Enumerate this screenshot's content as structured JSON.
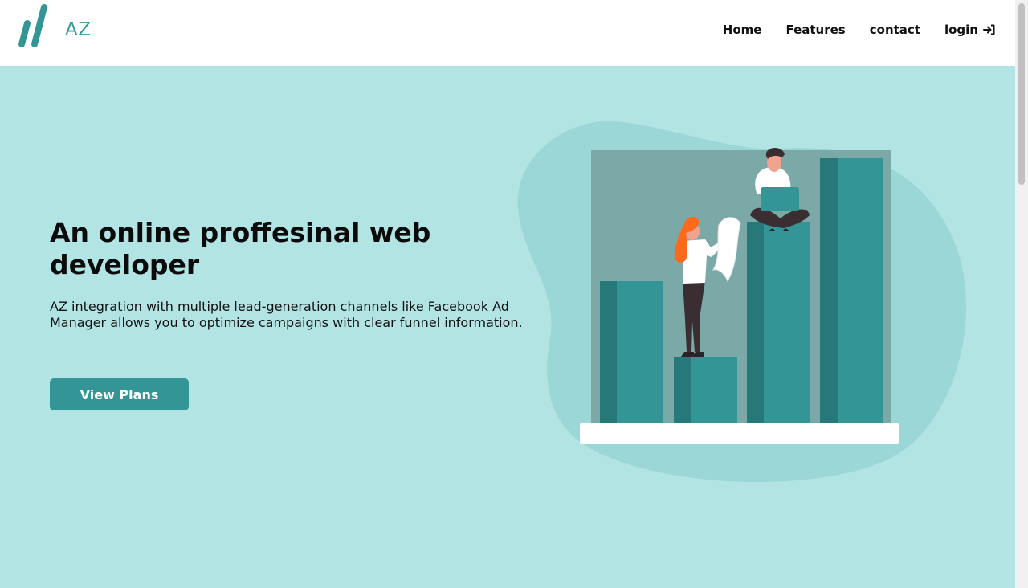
{
  "brand": {
    "name": "AZ",
    "accent": "#339595"
  },
  "nav": {
    "items": [
      {
        "label": "Home"
      },
      {
        "label": "Features"
      },
      {
        "label": "contact"
      },
      {
        "label": "login",
        "icon": "login-icon"
      }
    ]
  },
  "hero": {
    "headline": "An online proffesinal web developer",
    "description": "AZ integration with multiple lead-generation channels like Facebook Ad Manager allows you to optimize campaigns with clear funnel information.",
    "cta_label": "View Plans",
    "background": "#b3e4e4"
  }
}
